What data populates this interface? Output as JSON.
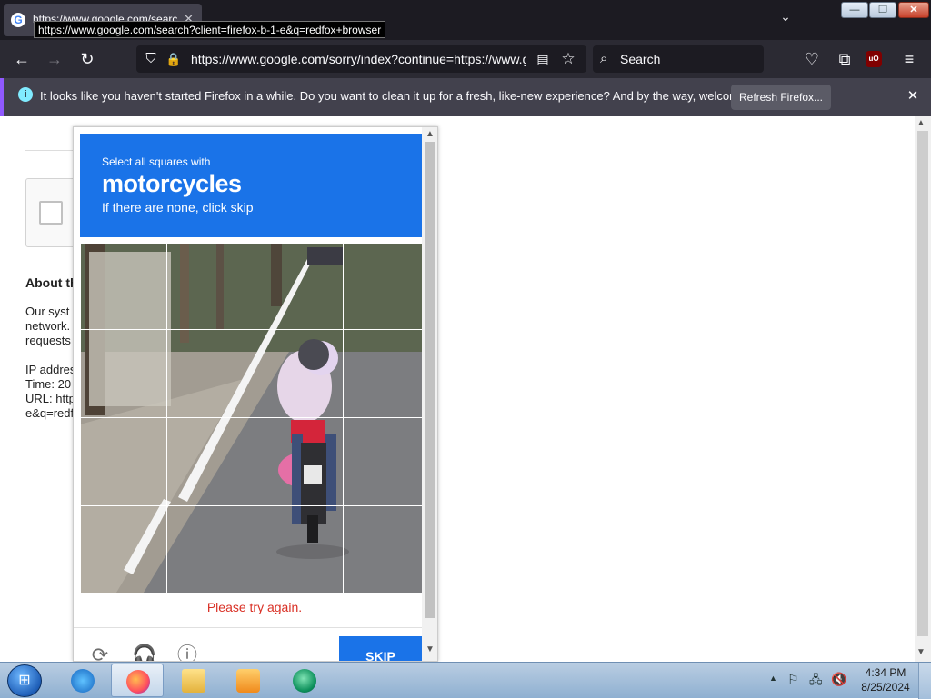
{
  "browser": {
    "tab": {
      "favicon": "G",
      "title": "https://www.google.com/search?client",
      "close": "✕"
    },
    "tooltip": "https://www.google.com/search?client=firefox-b-1-e&q=redfox+browser",
    "nav": {
      "back": "←",
      "forward": "→",
      "reload": "↻",
      "shield": "⛉",
      "lock": "🔒",
      "url": "https://www.google.com/sorry/index?continue=https://www.g",
      "reader": "▤",
      "star": "☆",
      "pocket": "♡",
      "extensions": "⧉",
      "ublock": "uO",
      "menu": "≡"
    },
    "search": {
      "icon": "⌕",
      "placeholder": "Search"
    },
    "tab_list": "⌄",
    "window": {
      "minimize": "—",
      "maximize": "❐",
      "close": "✕"
    }
  },
  "notification": {
    "icon": "i",
    "message": "It looks like you haven't started Firefox in a while. Do you want to clean it up for a fresh, like-new experience? And by the way, welcome back!",
    "button": "Refresh Firefox...",
    "close": "✕"
  },
  "page": {
    "about_heading": "About th",
    "lines": [
      "Our syst",
      "network.",
      "requests",
      "IP addres",
      "Time: 20",
      "URL: http",
      "e&q=redf"
    ]
  },
  "captcha": {
    "instruction": "Select all squares with",
    "target": "motorcycles",
    "subtext": "If there are none, click skip",
    "error": "Please try again.",
    "reload_icon": "⟳",
    "audio_icon": "🎧",
    "info_icon": "ⓘ",
    "skip": "SKIP",
    "colors": {
      "header": "#1a73e8",
      "error": "#d93025"
    }
  },
  "taskbar": {
    "start": "⊞",
    "apps": [
      "internet-explorer",
      "firefox",
      "file-explorer",
      "media-player",
      "app-green"
    ],
    "tray": {
      "arrow": "▲",
      "flag": "⚐",
      "network": "🖧",
      "sound": "🔇",
      "time": "4:34 PM",
      "date": "8/25/2024"
    }
  }
}
